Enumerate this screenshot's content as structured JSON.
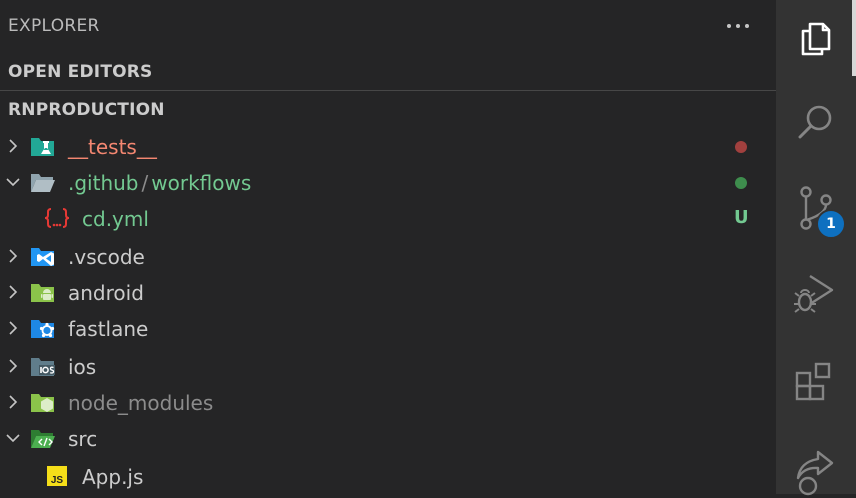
{
  "explorer": {
    "title": "EXPLORER",
    "more_actions_label": "···"
  },
  "sections": {
    "open_editors": "OPEN EDITORS",
    "project_name": "RNPRODUCTION"
  },
  "tree": {
    "tests": {
      "label": "__tests__",
      "color": "#f48771",
      "status_color": "#a1403e",
      "icon": "test-folder-icon"
    },
    "github": {
      "label_part1": ".github",
      "separator": "/",
      "label_part2": "workflows",
      "color": "#73c991",
      "status_color": "#3e8d4d",
      "icon": "folder-open-icon"
    },
    "cd_yml": {
      "label": "cd.yml",
      "status": "U",
      "color": "#73c991",
      "icon": "yaml-icon"
    },
    "vscode": {
      "label": ".vscode",
      "icon": "vscode-folder-icon"
    },
    "android": {
      "label": "android",
      "icon": "android-folder-icon"
    },
    "fastlane": {
      "label": "fastlane",
      "icon": "fastlane-folder-icon"
    },
    "ios": {
      "label": "ios",
      "icon": "ios-folder-icon"
    },
    "node_modules": {
      "label": "node_modules",
      "color": "#8c8c8c",
      "icon": "node-folder-icon"
    },
    "src": {
      "label": "src",
      "icon": "src-folder-icon"
    },
    "app_js": {
      "label": "App.js",
      "icon": "js-file-icon"
    }
  },
  "activity_bar": {
    "items": [
      "explorer-icon",
      "search-icon",
      "source-control-icon",
      "run-debug-icon",
      "extensions-icon",
      "remote-icon"
    ],
    "source_control_badge": "1"
  }
}
